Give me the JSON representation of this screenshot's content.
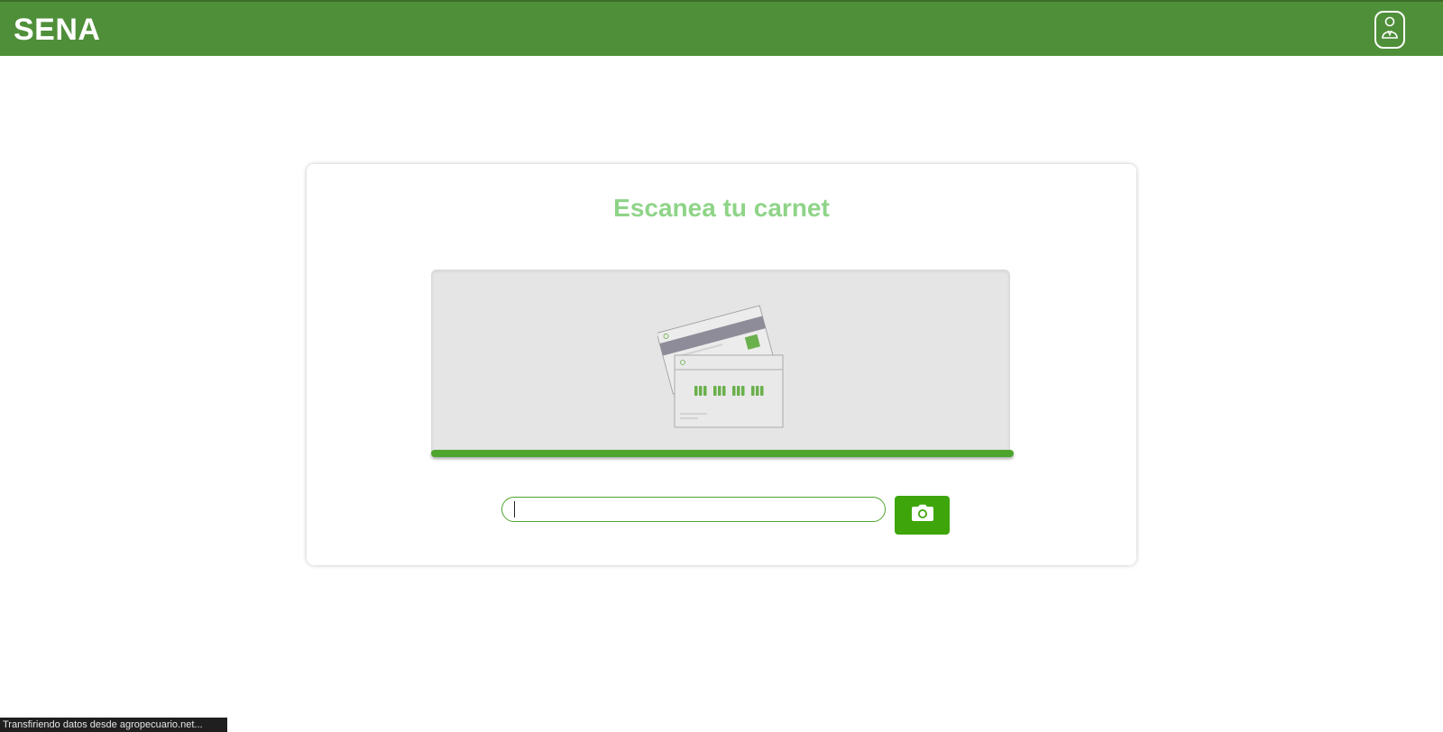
{
  "header": {
    "brand": "SENA",
    "user_icon": "user-badge-icon",
    "background_color": "#4f8f39"
  },
  "scanner": {
    "title": "Escanea tu carnet",
    "title_color": "#8fd488",
    "illustration_icon": "id-card-scan-icon",
    "progress": 1.0,
    "progress_color": "#4ea52d",
    "input_value": "",
    "input_placeholder": "",
    "camera_icon": "camera-icon",
    "camera_button_color": "#3ea50a"
  },
  "status_bar": {
    "text": "Transfiriendo datos desde agropecuario.net..."
  }
}
